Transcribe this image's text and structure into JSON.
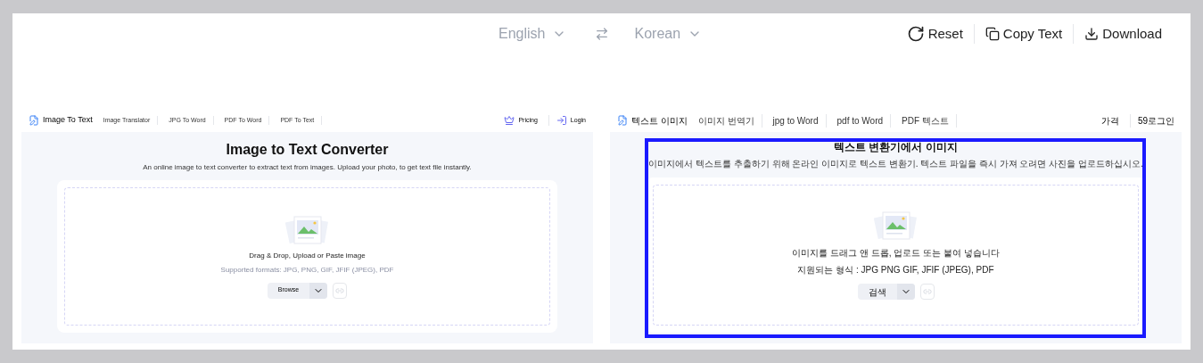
{
  "toolbar": {
    "source_language": "English",
    "target_language": "Korean",
    "actions": [
      {
        "kind": "reset",
        "label": "Reset"
      },
      {
        "kind": "copy",
        "label": "Copy Text"
      },
      {
        "kind": "download",
        "label": "Download"
      }
    ]
  },
  "panels": [
    {
      "highlighted": false,
      "logo": "Image To Text",
      "nav": [
        "Image Translator",
        "JPG To Word",
        "PDF To Word",
        "PDF To Text"
      ],
      "pricing": "Pricing",
      "login": "Login",
      "title": "Image to Text Converter",
      "subtitle": "An online image to text converter to extract text from images. Upload your photo, to get text file instantly.",
      "drop_text": "Drag & Drop, Upload or Paste image",
      "formats": "Supported formats: JPG, PNG, GIF, JFIF (JPEG), PDF",
      "browse": "Browse"
    },
    {
      "highlighted": true,
      "logo": "텍스트 이미지",
      "nav": [
        "이미지 번역기",
        "jpg to Word",
        "pdf to Word",
        "PDF 텍스트"
      ],
      "pricing": "가격",
      "login": "59로그인",
      "title": "텍스트 변환기에서 이미지",
      "subtitle": "이미지에서 텍스트를 추출하기 위해 온라인 이미지로 텍스트 변환기. 텍스트 파일을 즉시 가져 오려면 사진을 업로드하십시오.",
      "drop_text": "이미지를 드래그 앤 드롭, 업로드 또는 붙여 넣습니다",
      "formats": "지원되는 형식 : JPG PNG GIF, JFIF (JPEG), PDF",
      "browse": "검색"
    }
  ]
}
